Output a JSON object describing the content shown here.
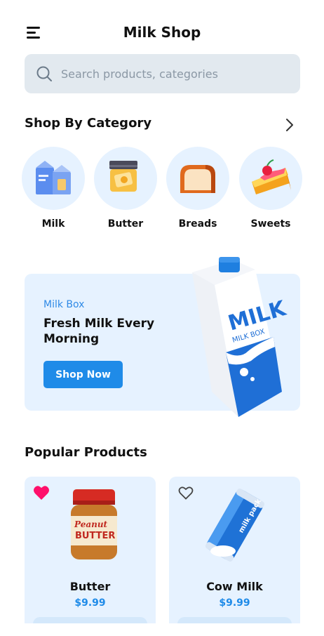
{
  "header": {
    "title": "Milk Shop"
  },
  "search": {
    "placeholder": "Search products, categories"
  },
  "categories_section": {
    "title": "Shop By Category",
    "items": [
      {
        "label": "Milk",
        "icon": "milk-carton-icon"
      },
      {
        "label": "Butter",
        "icon": "butter-jar-icon"
      },
      {
        "label": "Breads",
        "icon": "bread-icon"
      },
      {
        "label": "Sweets",
        "icon": "cake-slice-icon"
      }
    ]
  },
  "banner": {
    "subtitle": "Milk Box",
    "title": "Fresh Milk Every Morning",
    "button_label": "Shop Now",
    "carton_text": "MILK",
    "carton_subtext": "MILK BOX"
  },
  "popular_section": {
    "title": "Popular Products",
    "products": [
      {
        "name": "Butter",
        "price": "$9.99",
        "favorite": true,
        "jar_text": "BUTTER"
      },
      {
        "name": "Cow Milk",
        "price": "$9.99",
        "favorite": false,
        "pack_text": "milk pack"
      }
    ]
  },
  "colors": {
    "accent": "#1f8be8",
    "card_bg": "#e6f2ff",
    "favorite": "#ff0f6b"
  }
}
